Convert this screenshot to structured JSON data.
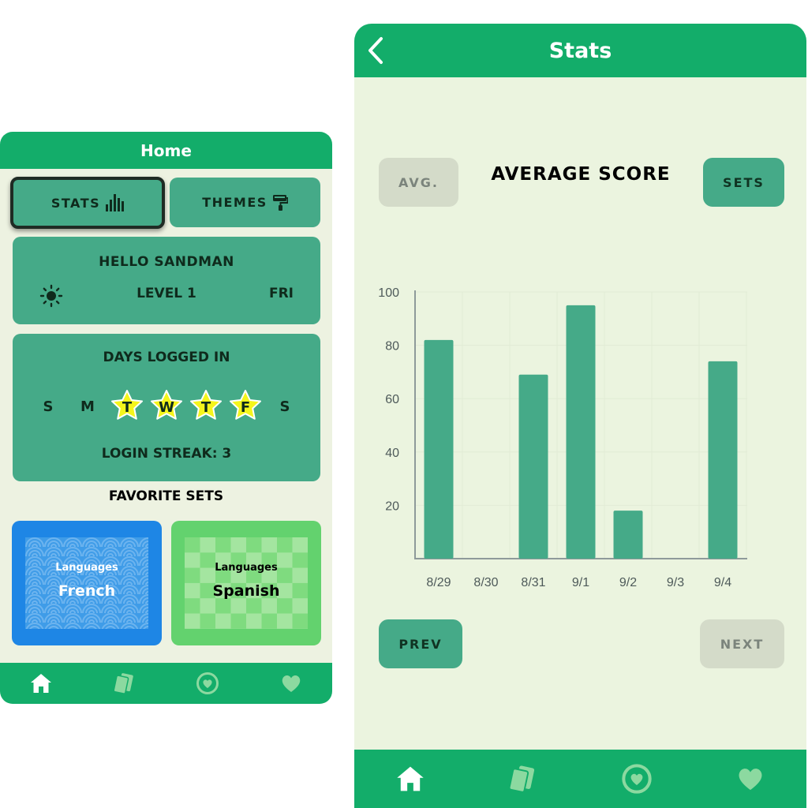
{
  "home": {
    "title": "Home",
    "tabs": [
      {
        "label": "STATS",
        "icon": "bar-chart-icon",
        "selected": true
      },
      {
        "label": "THEMES",
        "icon": "paint-roller-icon",
        "selected": false
      }
    ],
    "greeting": {
      "title": "HELLO SANDMAN",
      "level": "LEVEL 1",
      "day": "FRI",
      "icon": "sun-icon"
    },
    "days_logged_in": {
      "title": "DAYS LOGGED IN",
      "days": [
        {
          "letter": "S",
          "logged": false
        },
        {
          "letter": "M",
          "logged": false
        },
        {
          "letter": "T",
          "logged": true
        },
        {
          "letter": "W",
          "logged": true
        },
        {
          "letter": "T",
          "logged": true
        },
        {
          "letter": "F",
          "logged": true
        },
        {
          "letter": "S",
          "logged": false
        }
      ],
      "streak": "LOGIN STREAK: 3"
    },
    "favorite_sets": {
      "title": "FAVORITE SETS",
      "sets": [
        {
          "category": "Languages",
          "name": "French",
          "color": "#1e86e5",
          "pattern": "waves"
        },
        {
          "category": "Languages",
          "name": "Spanish",
          "color": "#63d26e",
          "pattern": "checkers"
        }
      ]
    },
    "tabbar": [
      "home-icon",
      "cards-icon",
      "heart-circle-icon",
      "heart-icon"
    ]
  },
  "stats": {
    "title": "Stats",
    "avg_button": "AVG.",
    "sets_button": "SETS",
    "heading": "AVERAGE SCORE",
    "prev": "PREV",
    "next": "NEXT",
    "tabbar": [
      "home-icon",
      "cards-icon",
      "heart-circle-icon",
      "heart-icon"
    ]
  },
  "colors": {
    "primary": "#13ad6a",
    "tile": "#45aa88",
    "background": "#ebf4df",
    "disabled": "#d4dbc9",
    "star": "#f5f51c"
  },
  "chart_data": {
    "type": "bar",
    "title": "AVERAGE SCORE",
    "categories": [
      "8/29",
      "8/30",
      "8/31",
      "9/1",
      "9/2",
      "9/3",
      "9/4"
    ],
    "values": [
      82,
      0,
      69,
      95,
      18,
      0,
      74
    ],
    "yticks": [
      20,
      40,
      60,
      80,
      100
    ],
    "ylim": [
      0,
      100
    ],
    "xlabel": "",
    "ylabel": "",
    "grid": true
  }
}
